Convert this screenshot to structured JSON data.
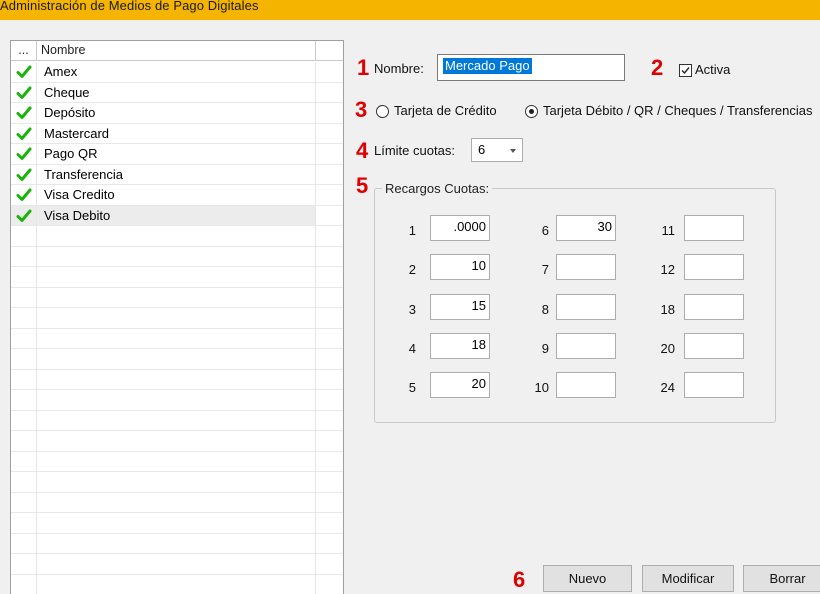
{
  "window": {
    "title": "Administración de Medios de Pago Digitales"
  },
  "grid": {
    "col_dots": "...",
    "col_name": "Nombre",
    "rows": [
      {
        "name": "Amex",
        "active": true
      },
      {
        "name": "Cheque",
        "active": true
      },
      {
        "name": "Depósito",
        "active": true
      },
      {
        "name": "Mastercard",
        "active": true
      },
      {
        "name": "Pago QR",
        "active": true
      },
      {
        "name": "Transferencia",
        "active": true
      },
      {
        "name": "Visa Credito",
        "active": true
      },
      {
        "name": "Visa Debito",
        "active": true
      }
    ],
    "selected_index": 7
  },
  "steps": [
    "1",
    "2",
    "3",
    "4",
    "5",
    "6"
  ],
  "form": {
    "nombre_label": "Nombre:",
    "nombre_value": "Mercado Pago",
    "activa_label": "Activa",
    "activa_checked": true,
    "radio_credito": "Tarjeta de Crédito",
    "radio_debito": "Tarjeta Débito / QR / Cheques / Transferencias",
    "radio_selected": "debito",
    "limite_label": "Límite cuotas:",
    "limite_value": "6"
  },
  "recargos": {
    "title": "Recargos Cuotas:",
    "col1": [
      {
        "n": "1",
        "v": ".0000"
      },
      {
        "n": "2",
        "v": "10"
      },
      {
        "n": "3",
        "v": "15"
      },
      {
        "n": "4",
        "v": "18"
      },
      {
        "n": "5",
        "v": "20"
      }
    ],
    "col2": [
      {
        "n": "6",
        "v": "30"
      },
      {
        "n": "7",
        "v": ""
      },
      {
        "n": "8",
        "v": ""
      },
      {
        "n": "9",
        "v": ""
      },
      {
        "n": "10",
        "v": ""
      }
    ],
    "col3": [
      {
        "n": "11",
        "v": ""
      },
      {
        "n": "12",
        "v": ""
      },
      {
        "n": "18",
        "v": ""
      },
      {
        "n": "20",
        "v": ""
      },
      {
        "n": "24",
        "v": ""
      }
    ]
  },
  "buttons": {
    "nuevo": "Nuevo",
    "modificar": "Modificar",
    "borrar": "Borrar"
  },
  "colors": {
    "titlebar": "#f5b400",
    "step": "#e00000",
    "check": "#19b40a",
    "selection": "#0078d7"
  }
}
